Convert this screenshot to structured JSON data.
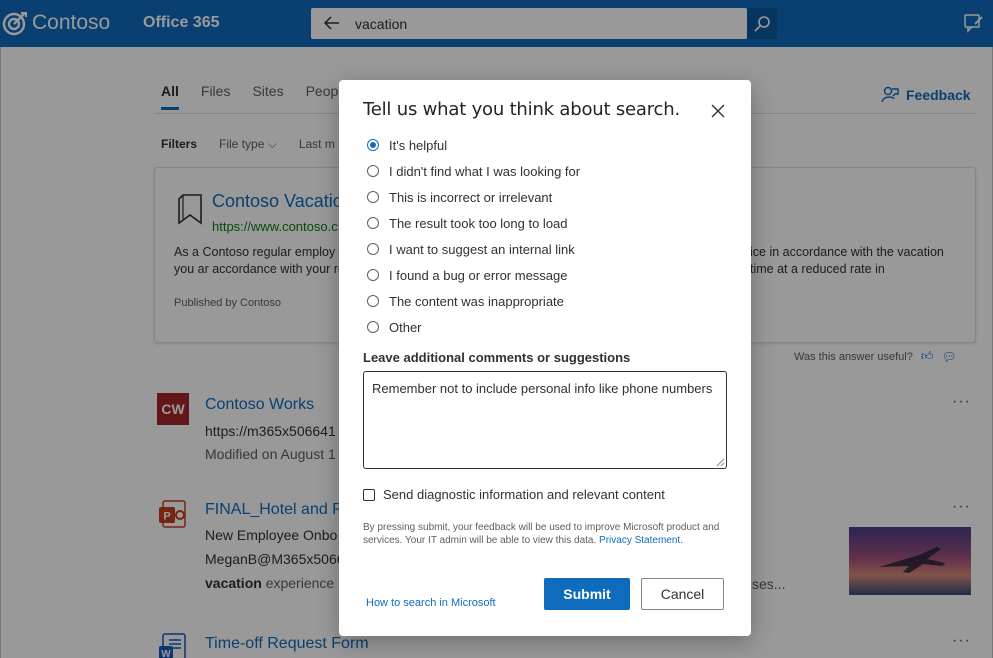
{
  "header": {
    "brand": "Contoso",
    "app": "Office 365",
    "search_query": "vacation"
  },
  "tabs": [
    "All",
    "Files",
    "Sites",
    "Peopl"
  ],
  "feedback_label": "Feedback",
  "filters": {
    "title": "Filters",
    "items": [
      "File type",
      "Last m"
    ]
  },
  "answer_card": {
    "title": "Contoso Vacatio",
    "url": "https://www.contoso.c",
    "desc_left": "As a Contoso regular employ following schedule. If you ar accordance with your reduce",
    "desc_right": "ice in accordance with the vacation time at a reduced rate in",
    "published": "Published by Contoso",
    "useful_prompt": "Was this answer useful?"
  },
  "results": [
    {
      "icon_text": "CW",
      "title": "Contoso Works",
      "line1": "https://m365x506641",
      "line2": "Modified on August 1"
    },
    {
      "icon_text": "P",
      "title": "FINAL_Hotel and R",
      "line1": "New Employee Onbo",
      "line2": "MeganB@M365x5066",
      "line3_bold": "vacation",
      "line3_rest": " experience l",
      "line3_tail": "ses..."
    },
    {
      "icon_text": "W",
      "title": "Time-off Request Form"
    }
  ],
  "dialog": {
    "title": "Tell us what you think about search.",
    "options": [
      "It's helpful",
      "I didn't find what I was looking for",
      "This is incorrect or irrelevant",
      "The result took too long to load",
      "I want to suggest an internal link",
      "I found a bug or error message",
      "The content was inappropriate",
      "Other"
    ],
    "selected_option": "It's helpful",
    "comments_label": "Leave additional comments or suggestions",
    "comments_value": "Remember not to include personal info like phone numbers",
    "diagnostic_label": "Send diagnostic information and relevant content",
    "diagnostic_checked": false,
    "legal_text": "By pressing submit, your feedback will be used to improve Microsoft product and services. Your IT admin will be able to view this data. ",
    "legal_link": "Privacy Statement.",
    "help_link": "How to search in Microsoft",
    "submit_label": "Submit",
    "cancel_label": "Cancel"
  },
  "colors": {
    "brand_blue": "#0f6cbd",
    "overlay": "rgba(0,0,0,0.40)"
  }
}
